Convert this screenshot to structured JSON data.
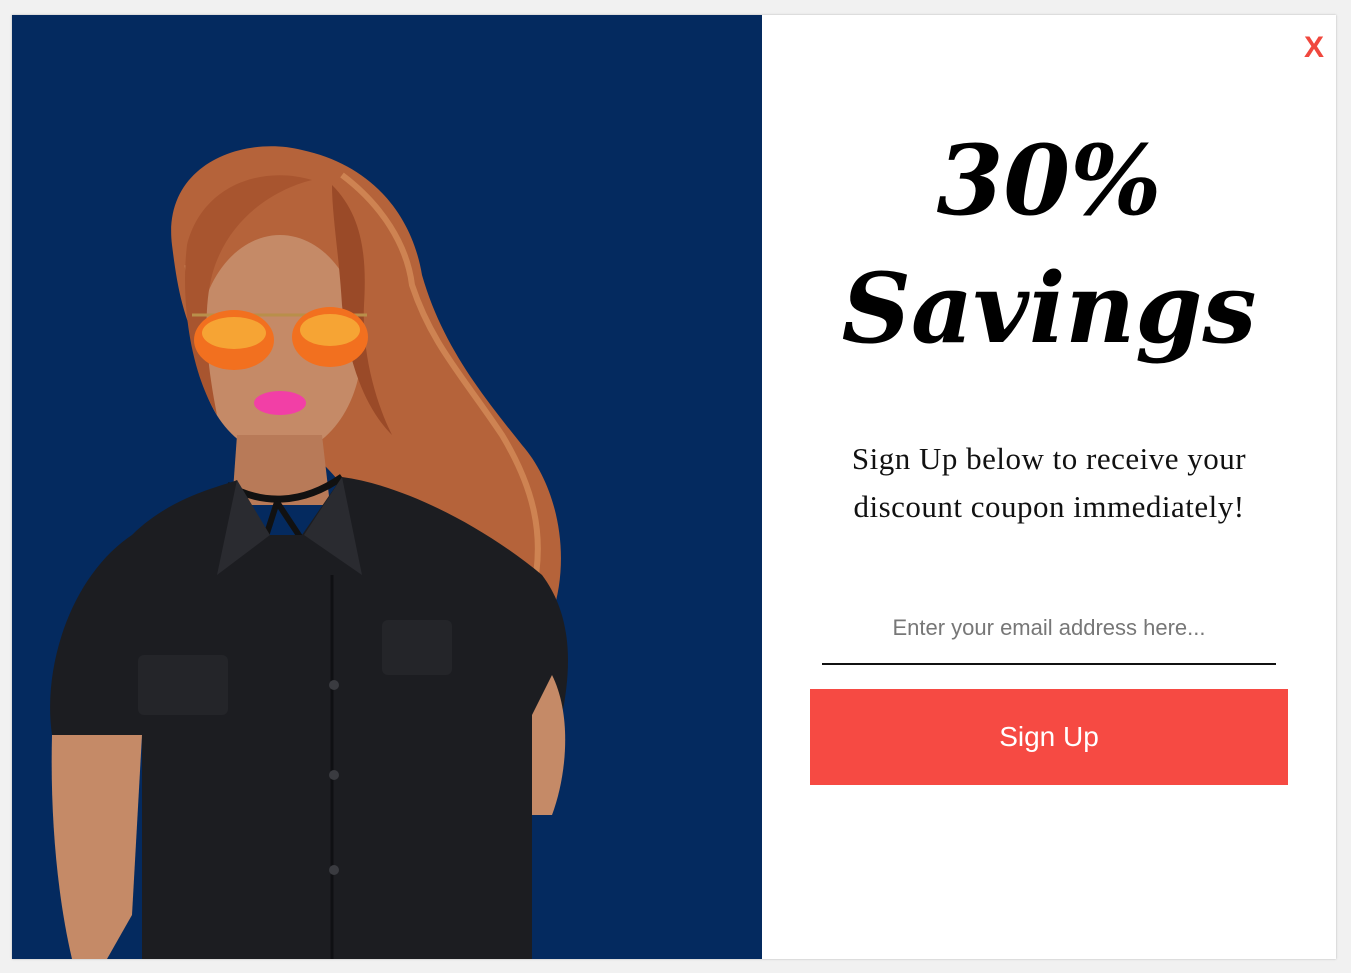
{
  "popup": {
    "close_label": "X",
    "headline_line1": "30%",
    "headline_line2": "Savings",
    "subtext": "Sign Up below to receive your discount coupon immediately!",
    "email_placeholder": "Enter your email address here...",
    "email_value": "",
    "signup_label": "Sign Up"
  },
  "colors": {
    "left_background": "#042a5f",
    "accent": "#f64a43",
    "close": "#f0483e"
  }
}
